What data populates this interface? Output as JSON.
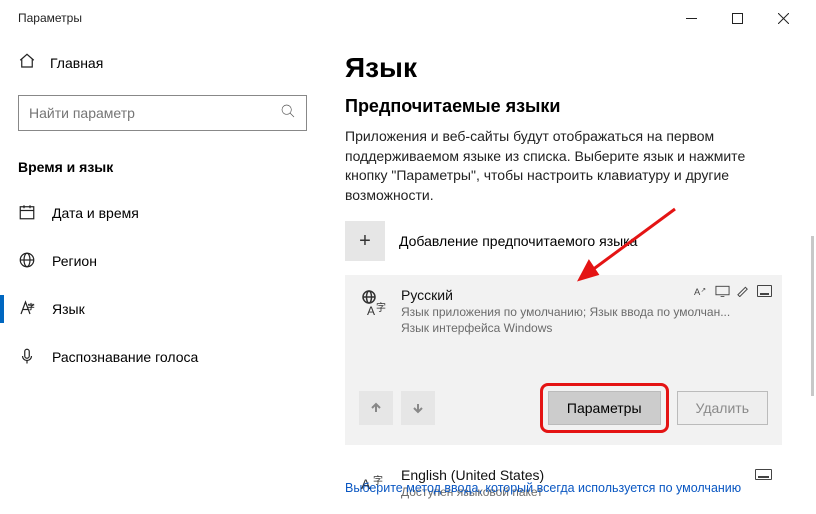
{
  "window": {
    "title": "Параметры"
  },
  "sidebar": {
    "home": "Главная",
    "search_placeholder": "Найти параметр",
    "section": "Время и язык",
    "items": [
      {
        "label": "Дата и время"
      },
      {
        "label": "Регион"
      },
      {
        "label": "Язык"
      },
      {
        "label": "Распознавание голоса"
      }
    ]
  },
  "main": {
    "title": "Язык",
    "subtitle": "Предпочитаемые языки",
    "description": "Приложения и веб-сайты будут отображаться на первом поддерживаемом языке из списка. Выберите язык и нажмите кнопку \"Параметры\", чтобы настроить клавиатуру и другие возможности.",
    "add_label": "Добавление предпочитаемого языка",
    "languages": [
      {
        "name": "Русский",
        "sub": "Язык приложения по умолчанию; Язык ввода по умолчан...",
        "sub2": "Язык интерфейса Windows"
      },
      {
        "name": "English (United States)",
        "sub": "Доступен языковой пакет"
      }
    ],
    "actions": {
      "options": "Параметры",
      "remove": "Удалить"
    },
    "footer": "Выберите метод ввода, который всегда используется по умолчанию"
  }
}
